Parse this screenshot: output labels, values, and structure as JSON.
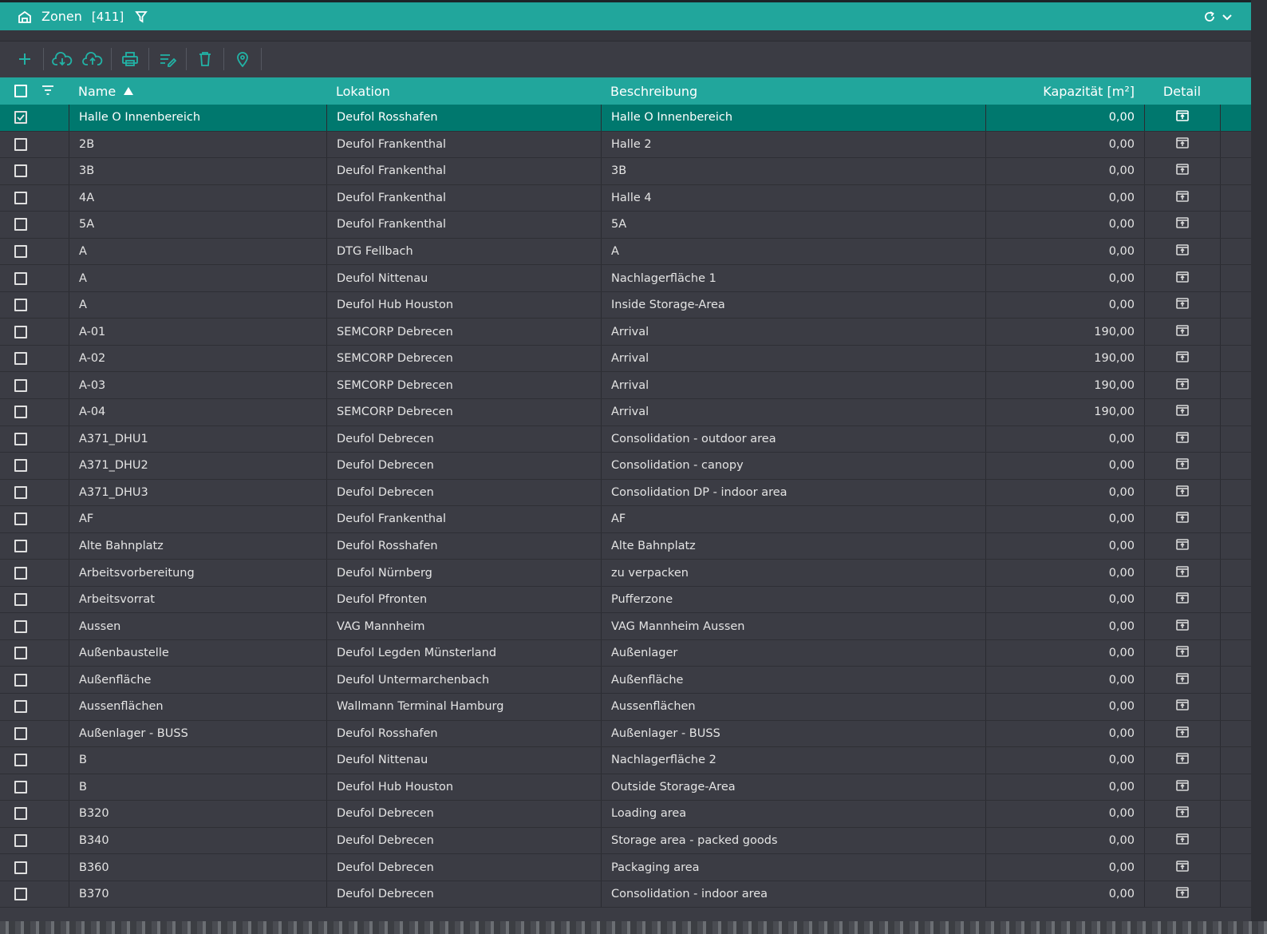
{
  "window": {
    "title": "Zonen",
    "count": "[411]",
    "icons": [
      "warehouse-icon",
      "filter-icon",
      "refresh-icon",
      "chevron-down-icon"
    ]
  },
  "toolbar": {
    "buttons": [
      {
        "name": "add-icon"
      },
      {
        "name": "cloud-download-icon"
      },
      {
        "name": "cloud-upload-icon"
      },
      {
        "name": "print-icon"
      },
      {
        "name": "edit-list-icon"
      },
      {
        "name": "delete-icon"
      },
      {
        "name": "location-pin-icon"
      }
    ]
  },
  "table": {
    "columns": {
      "name": "Name",
      "location": "Lokation",
      "description": "Beschreibung",
      "capacity": "Kapazität [m²]",
      "detail": "Detail"
    },
    "sort": {
      "column": "name",
      "direction": "ascending"
    },
    "rows": [
      {
        "name": "Halle O Innenbereich",
        "location": "Deufol Rosshafen",
        "description": "Halle O Innenbereich",
        "capacity": "0,00",
        "selected": true
      },
      {
        "name": "2B",
        "location": "Deufol Frankenthal",
        "description": "Halle 2",
        "capacity": "0,00"
      },
      {
        "name": "3B",
        "location": "Deufol Frankenthal",
        "description": "3B",
        "capacity": "0,00"
      },
      {
        "name": "4A",
        "location": "Deufol Frankenthal",
        "description": "Halle 4",
        "capacity": "0,00"
      },
      {
        "name": "5A",
        "location": "Deufol Frankenthal",
        "description": "5A",
        "capacity": "0,00"
      },
      {
        "name": "A",
        "location": "DTG Fellbach",
        "description": "A",
        "capacity": "0,00"
      },
      {
        "name": "A",
        "location": "Deufol Nittenau",
        "description": "Nachlagerfläche 1",
        "capacity": "0,00"
      },
      {
        "name": "A",
        "location": "Deufol Hub Houston",
        "description": "Inside Storage-Area",
        "capacity": "0,00"
      },
      {
        "name": "A-01",
        "location": "SEMCORP Debrecen",
        "description": "Arrival",
        "capacity": "190,00"
      },
      {
        "name": "A-02",
        "location": "SEMCORP Debrecen",
        "description": "Arrival",
        "capacity": "190,00"
      },
      {
        "name": "A-03",
        "location": "SEMCORP Debrecen",
        "description": "Arrival",
        "capacity": "190,00"
      },
      {
        "name": "A-04",
        "location": "SEMCORP Debrecen",
        "description": "Arrival",
        "capacity": "190,00"
      },
      {
        "name": "A371_DHU1",
        "location": "Deufol Debrecen",
        "description": "Consolidation - outdoor area",
        "capacity": "0,00"
      },
      {
        "name": "A371_DHU2",
        "location": "Deufol Debrecen",
        "description": "Consolidation - canopy",
        "capacity": "0,00"
      },
      {
        "name": "A371_DHU3",
        "location": "Deufol Debrecen",
        "description": "Consolidation DP - indoor area",
        "capacity": "0,00"
      },
      {
        "name": "AF",
        "location": "Deufol Frankenthal",
        "description": "AF",
        "capacity": "0,00"
      },
      {
        "name": "Alte Bahnplatz",
        "location": "Deufol Rosshafen",
        "description": "Alte Bahnplatz",
        "capacity": "0,00"
      },
      {
        "name": "Arbeitsvorbereitung",
        "location": "Deufol Nürnberg",
        "description": "zu verpacken",
        "capacity": "0,00"
      },
      {
        "name": "Arbeitsvorrat",
        "location": "Deufol Pfronten",
        "description": "Pufferzone",
        "capacity": "0,00"
      },
      {
        "name": "Aussen",
        "location": "VAG Mannheim",
        "description": "VAG Mannheim Aussen",
        "capacity": "0,00"
      },
      {
        "name": "Außenbaustelle",
        "location": "Deufol Legden Münsterland",
        "description": "Außenlager",
        "capacity": "0,00"
      },
      {
        "name": "Außenfläche",
        "location": "Deufol Untermarchenbach",
        "description": "Außenfläche",
        "capacity": "0,00"
      },
      {
        "name": "Aussenflächen",
        "location": "Wallmann Terminal Hamburg",
        "description": "Aussenflächen",
        "capacity": "0,00"
      },
      {
        "name": "Außenlager - BUSS",
        "location": "Deufol Rosshafen",
        "description": "Außenlager - BUSS",
        "capacity": "0,00"
      },
      {
        "name": "B",
        "location": "Deufol Nittenau",
        "description": "Nachlagerfläche 2",
        "capacity": "0,00"
      },
      {
        "name": "B",
        "location": "Deufol Hub Houston",
        "description": "Outside Storage-Area",
        "capacity": "0,00"
      },
      {
        "name": "B320",
        "location": "Deufol Debrecen",
        "description": "Loading area",
        "capacity": "0,00"
      },
      {
        "name": "B340",
        "location": "Deufol Debrecen",
        "description": "Storage area - packed goods",
        "capacity": "0,00"
      },
      {
        "name": "B360",
        "location": "Deufol Debrecen",
        "description": "Packaging area",
        "capacity": "0,00"
      },
      {
        "name": "B370",
        "location": "Deufol Debrecen",
        "description": "Consolidation - indoor area",
        "capacity": "0,00"
      }
    ]
  },
  "colors": {
    "accent": "#21a69c",
    "selected_row": "#00786e",
    "background": "#3b3c44",
    "icon_teal": "#22b3a6"
  }
}
